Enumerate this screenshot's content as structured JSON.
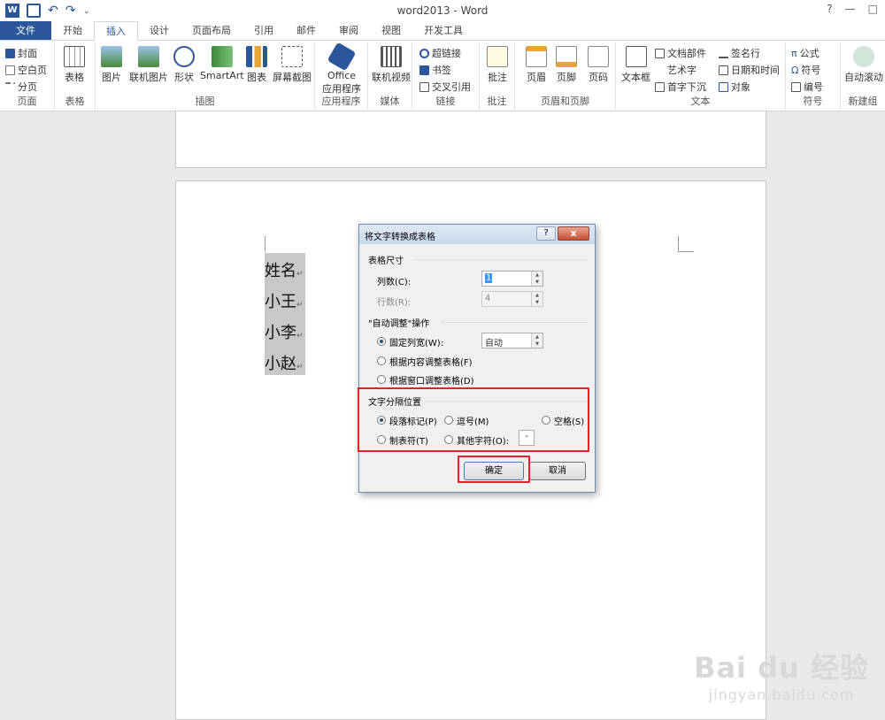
{
  "window": {
    "title": "word2013 - Word",
    "help": "?",
    "minimize": "—",
    "restore": "□"
  },
  "qat": {
    "word_icon": "W",
    "undo": "↶",
    "redo": "↷",
    "more": "⌄"
  },
  "tabs": [
    {
      "label": "文件"
    },
    {
      "label": "开始"
    },
    {
      "label": "插入"
    },
    {
      "label": "设计"
    },
    {
      "label": "页面布局"
    },
    {
      "label": "引用"
    },
    {
      "label": "邮件"
    },
    {
      "label": "审阅"
    },
    {
      "label": "视图"
    },
    {
      "label": "开发工具"
    }
  ],
  "ribbon": {
    "pages": {
      "label": "页面",
      "cover": "封面",
      "blank": "空白页",
      "break": "分页"
    },
    "tables": {
      "label": "表格",
      "table": "表格"
    },
    "illustrations": {
      "label": "插图",
      "picture": "图片",
      "online_picture": "联机图片",
      "shapes": "形状",
      "smartart": "SmartArt",
      "chart": "图表",
      "screenshot": "屏幕截图"
    },
    "apps": {
      "label": "应用程序",
      "office_line1": "Office",
      "office_line2": "应用程序"
    },
    "media": {
      "label": "媒体",
      "online_video": "联机视频"
    },
    "links": {
      "label": "链接",
      "hyperlink": "超链接",
      "bookmark": "书签",
      "cross_ref": "交叉引用"
    },
    "comments": {
      "label": "批注",
      "comment": "批注"
    },
    "header_footer": {
      "label": "页眉和页脚",
      "header": "页眉",
      "footer": "页脚",
      "page_number": "页码"
    },
    "text": {
      "label": "文本",
      "textbox": "文本框",
      "quick_parts": "文档部件",
      "wordart": "艺术字",
      "dropcap": "首字下沉",
      "signature": "签名行",
      "datetime": "日期和时间",
      "object": "对象"
    },
    "symbols": {
      "label": "符号",
      "equation": "公式",
      "symbol": "符号",
      "number": "编号"
    },
    "new_group": {
      "label": "新建组",
      "auto_scroll": "自动滚动"
    }
  },
  "document": {
    "lines": [
      "姓名",
      "小王",
      "小李",
      "小赵"
    ],
    "para_mark": "↵"
  },
  "dialog": {
    "title": "将文字转换成表格",
    "help": "?",
    "close": "x",
    "table_size": {
      "header": "表格尺寸",
      "columns_label": "列数(C):",
      "columns_value": "1",
      "rows_label": "行数(R):",
      "rows_value": "4"
    },
    "autofit": {
      "header": "\"自动调整\"操作",
      "fixed_label": "固定列宽(W):",
      "fixed_value": "自动",
      "content_label": "根据内容调整表格(F)",
      "window_label": "根据窗口调整表格(D)"
    },
    "separator": {
      "header": "文字分隔位置",
      "paragraph": "段落标记(P)",
      "comma": "逗号(M)",
      "space": "空格(S)",
      "tab": "制表符(T)",
      "other": "其他字符(O):",
      "other_value": "-"
    },
    "ok": "确定",
    "cancel": "取消"
  },
  "watermark": {
    "brand": "Bai du 经验",
    "url": "jingyan.baidu.com"
  },
  "colors": {
    "accent": "#2b579a",
    "highlight": "#e8202a"
  }
}
